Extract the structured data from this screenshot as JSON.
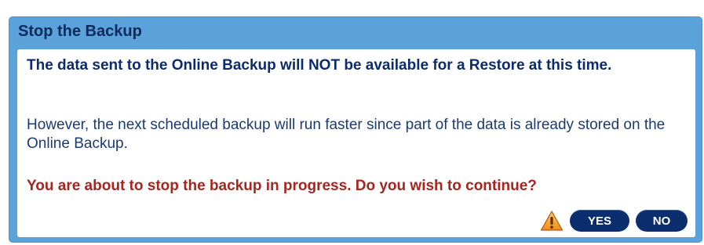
{
  "dialog": {
    "title": "Stop the Backup",
    "message_bold": "The data sent to the Online Backup will NOT be available for a Restore at this time.",
    "message_info": "However, the next scheduled backup will run faster since part of the data is already stored on the Online Backup.",
    "message_warning": "You are about to stop the backup in progress. Do you wish to continue?",
    "yes_label": "YES",
    "no_label": "NO",
    "warning_icon": "warning-triangle-icon"
  },
  "colors": {
    "title_bar": "#5aa2d9",
    "title_text": "#0d2a5c",
    "body_text": "#0c2b6b",
    "warning_text": "#a8251f",
    "button_bg": "#0b2f6e",
    "button_text": "#ffffff"
  }
}
